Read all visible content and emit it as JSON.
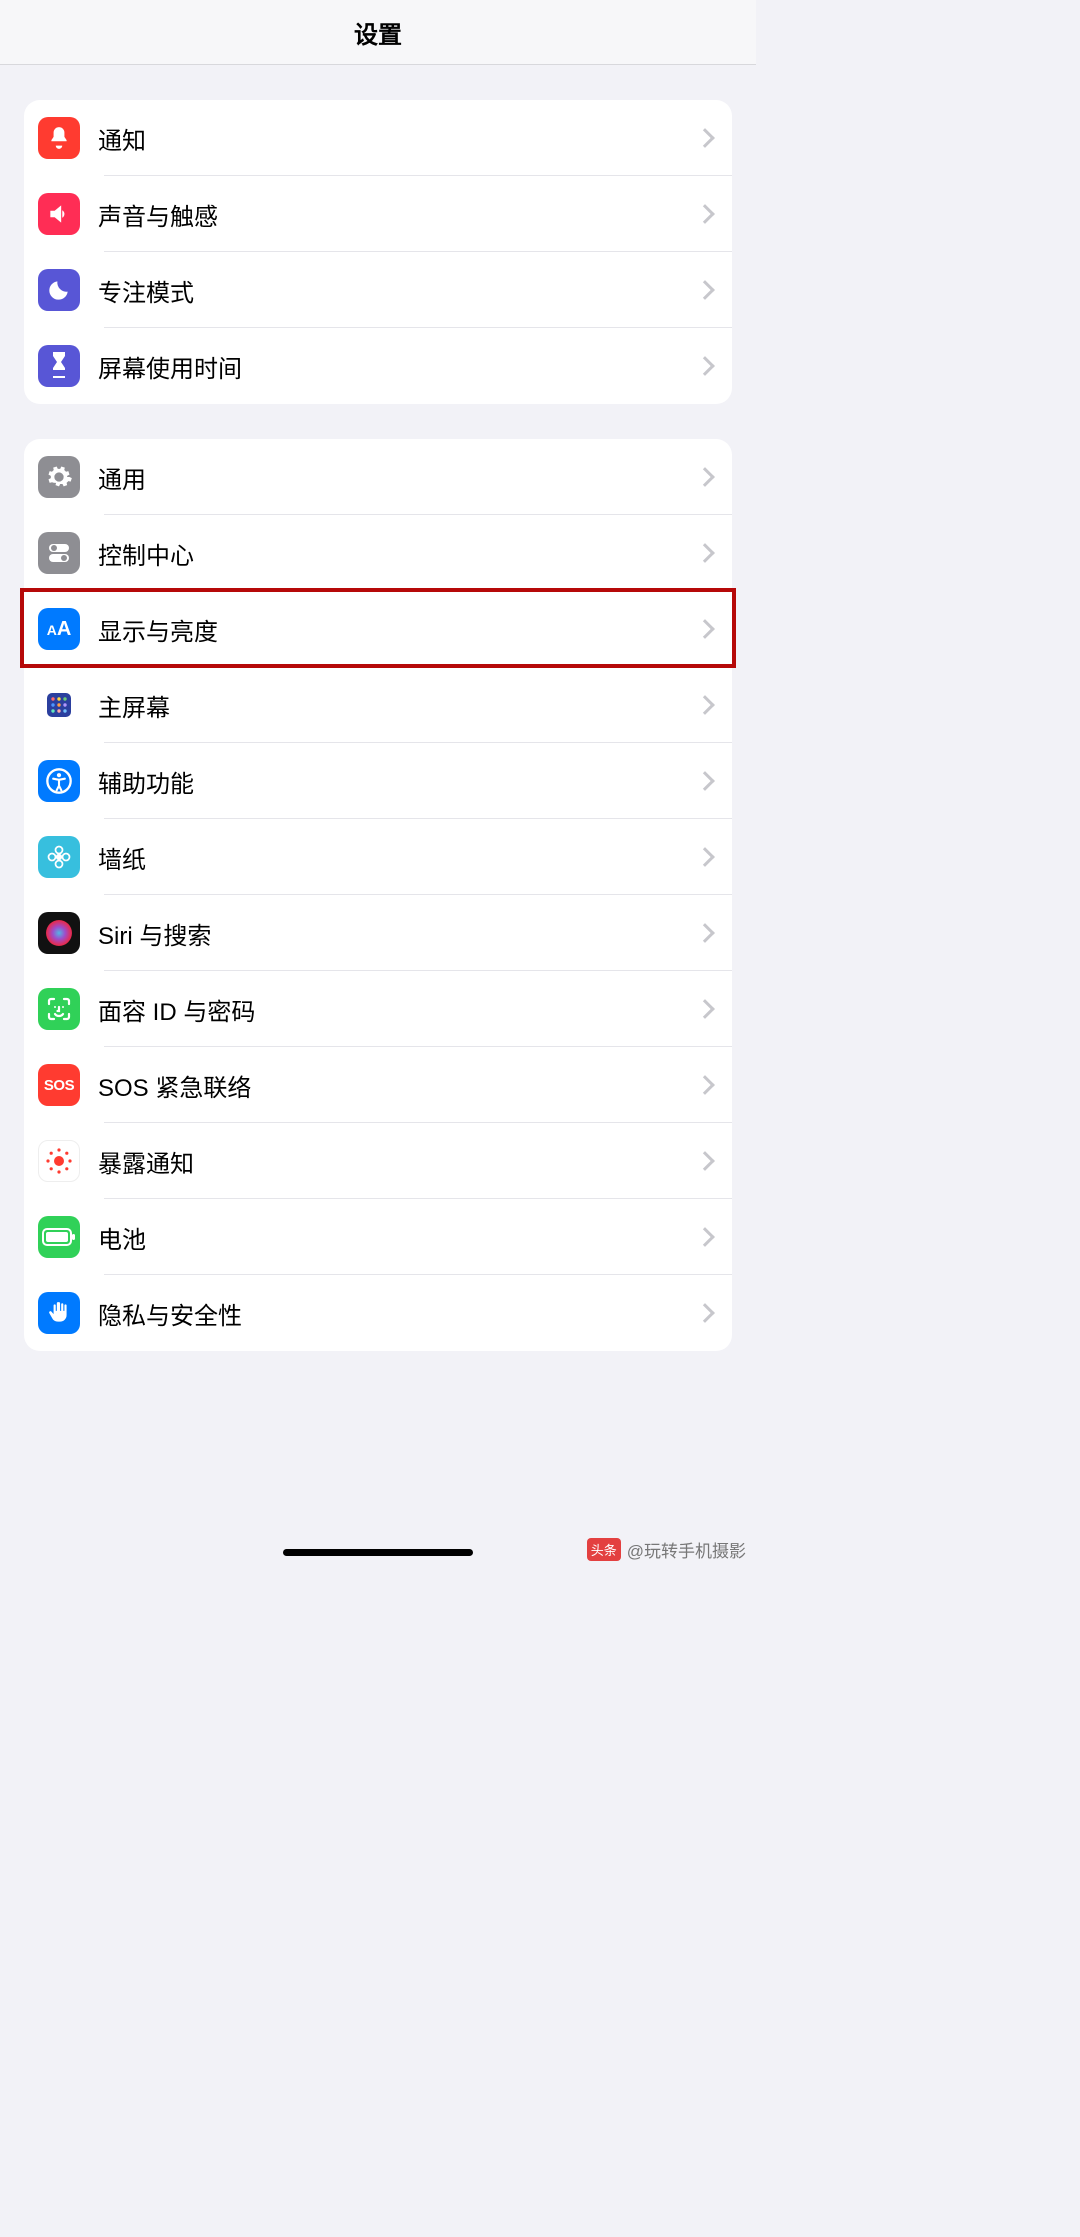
{
  "header": {
    "title": "设置"
  },
  "groups": [
    {
      "rows": [
        {
          "id": "notifications",
          "label": "通知",
          "icon": "bell-icon",
          "bg": "#ff3b30"
        },
        {
          "id": "sounds",
          "label": "声音与触感",
          "icon": "speaker-icon",
          "bg": "#ff2d55"
        },
        {
          "id": "focus",
          "label": "专注模式",
          "icon": "moon-icon",
          "bg": "#5856d6"
        },
        {
          "id": "screen-time",
          "label": "屏幕使用时间",
          "icon": "hourglass-icon",
          "bg": "#5856d6"
        }
      ]
    },
    {
      "rows": [
        {
          "id": "general",
          "label": "通用",
          "icon": "gear-icon",
          "bg": "#8e8e93"
        },
        {
          "id": "control-center",
          "label": "控制中心",
          "icon": "switches-icon",
          "bg": "#8e8e93"
        },
        {
          "id": "display",
          "label": "显示与亮度",
          "icon": "textsize-icon",
          "bg": "#007aff",
          "highlight": true
        },
        {
          "id": "home-screen",
          "label": "主屏幕",
          "icon": "appgrid-icon",
          "bg": "#3354c7"
        },
        {
          "id": "accessibility",
          "label": "辅助功能",
          "icon": "accessibility-icon",
          "bg": "#007aff"
        },
        {
          "id": "wallpaper",
          "label": "墙纸",
          "icon": "flower-icon",
          "bg": "#37bfde"
        },
        {
          "id": "siri",
          "label": "Siri 与搜索",
          "icon": "siri-icon",
          "bg": "#111111"
        },
        {
          "id": "faceid",
          "label": "面容 ID 与密码",
          "icon": "faceid-icon",
          "bg": "#30d158"
        },
        {
          "id": "sos",
          "label": "SOS 紧急联络",
          "icon": "sos-icon",
          "bg": "#ff3b30"
        },
        {
          "id": "exposure",
          "label": "暴露通知",
          "icon": "exposure-icon",
          "bg": "#ffffff"
        },
        {
          "id": "battery",
          "label": "电池",
          "icon": "battery-icon",
          "bg": "#30d158"
        },
        {
          "id": "privacy",
          "label": "隐私与安全性",
          "icon": "hand-icon",
          "bg": "#007aff"
        }
      ]
    }
  ],
  "watermark": {
    "badge": "头条",
    "text": "@玩转手机摄影"
  }
}
